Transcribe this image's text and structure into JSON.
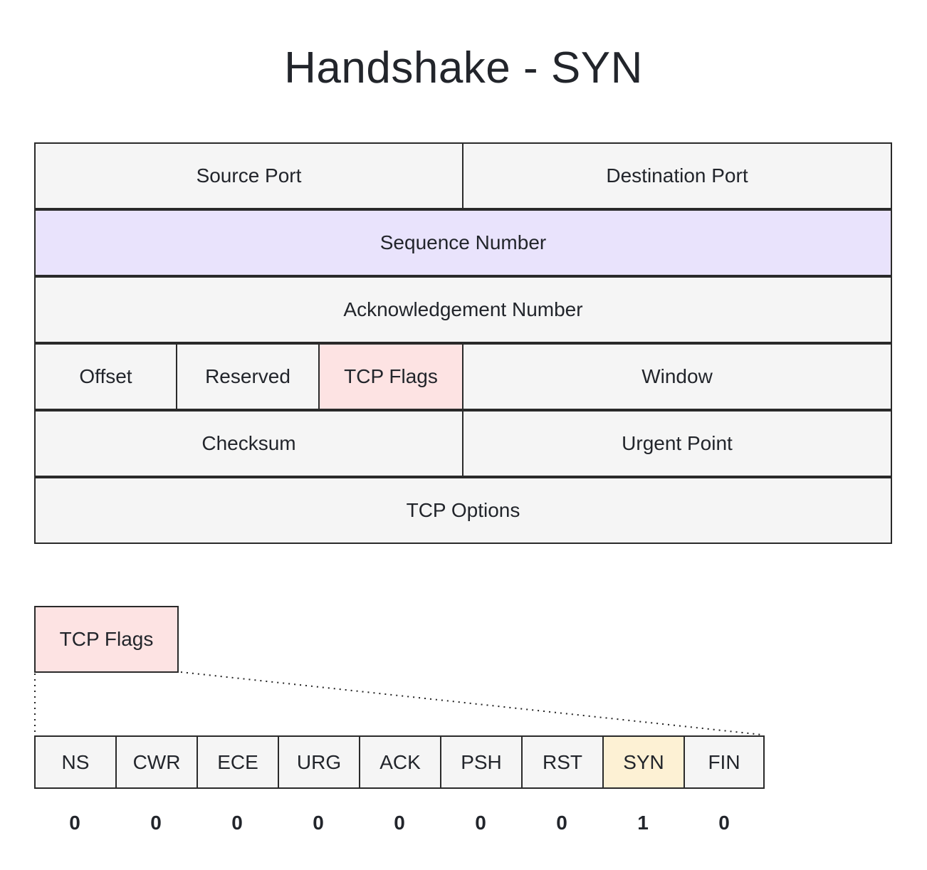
{
  "title": "Handshake - SYN",
  "header_fields": {
    "source_port": "Source Port",
    "destination_port": "Destination Port",
    "sequence_number": "Sequence Number",
    "acknowledgement_number": "Acknowledgement Number",
    "offset": "Offset",
    "reserved": "Reserved",
    "tcp_flags": "TCP Flags",
    "window": "Window",
    "checksum": "Checksum",
    "urgent_point": "Urgent Point",
    "tcp_options": "TCP Options"
  },
  "flags_detail": {
    "label": "TCP Flags",
    "flags": [
      {
        "name": "NS",
        "value": "0"
      },
      {
        "name": "CWR",
        "value": "0"
      },
      {
        "name": "ECE",
        "value": "0"
      },
      {
        "name": "URG",
        "value": "0"
      },
      {
        "name": "ACK",
        "value": "0"
      },
      {
        "name": "PSH",
        "value": "0"
      },
      {
        "name": "RST",
        "value": "0"
      },
      {
        "name": "SYN",
        "value": "1"
      },
      {
        "name": "FIN",
        "value": "0"
      }
    ]
  },
  "colors": {
    "default_fill": "#f5f5f5",
    "sequence_highlight": "#e9e3fc",
    "flags_highlight": "#fde3e3",
    "active_flag_highlight": "#fdf1d4",
    "border": "#2a2a2a",
    "text": "#22252b"
  }
}
